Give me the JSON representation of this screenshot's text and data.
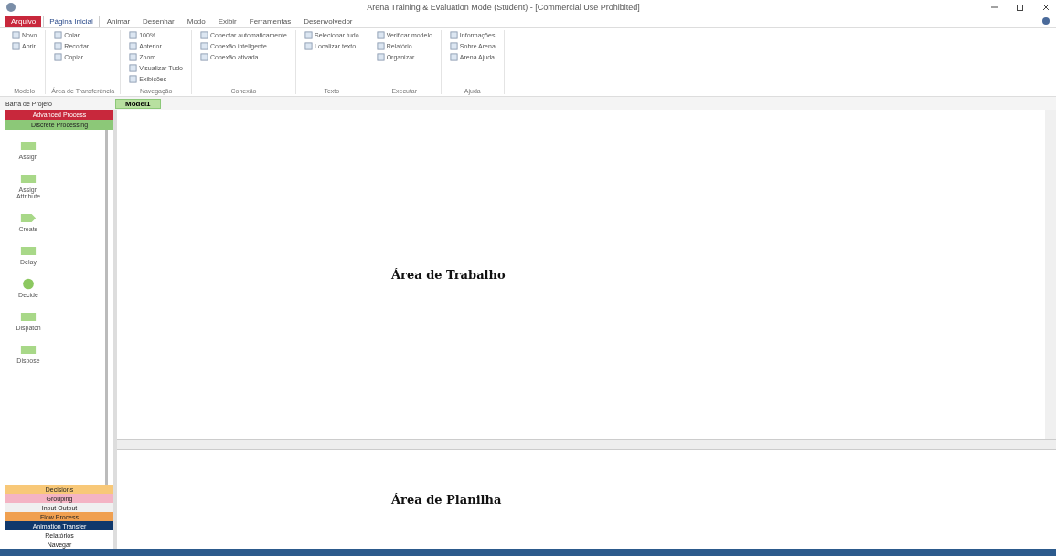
{
  "window": {
    "title": "Arena Training & Evaluation Mode (Student) - [Commercial Use Prohibited]"
  },
  "ribbon_tabs": [
    {
      "label": "Arquivo",
      "selected": false,
      "kind": "file"
    },
    {
      "label": "Página Inicial",
      "selected": true,
      "kind": "tab"
    },
    {
      "label": "Animar",
      "selected": false,
      "kind": "tab"
    },
    {
      "label": "Desenhar",
      "selected": false,
      "kind": "tab"
    },
    {
      "label": "Modo",
      "selected": false,
      "kind": "tab"
    },
    {
      "label": "Exibir",
      "selected": false,
      "kind": "tab"
    },
    {
      "label": "Ferramentas",
      "selected": false,
      "kind": "tab"
    },
    {
      "label": "Desenvolvedor",
      "selected": false,
      "kind": "tab"
    }
  ],
  "ribbon_groups": [
    {
      "label": "Modelo",
      "commands": [
        "Novo",
        "Abrir"
      ]
    },
    {
      "label": "Área de Transferência",
      "commands": [
        "Colar",
        "Recortar",
        "Copiar"
      ]
    },
    {
      "label": "Navegação",
      "commands": [
        "100%",
        "Anterior",
        "Zoom",
        "Visualizar Tudo",
        "Exibições"
      ]
    },
    {
      "label": "Conexão",
      "commands": [
        "Conectar automaticamente",
        "Conexão inteligente",
        "Conexão ativada"
      ]
    },
    {
      "label": "Texto",
      "commands": [
        "Selecionar tudo",
        "Localizar texto"
      ]
    },
    {
      "label": "Executar",
      "commands": [
        "Verificar modelo",
        "Relatório",
        "Organizar"
      ]
    },
    {
      "label": "Ajuda",
      "commands": [
        "Informações",
        "Sobre Arena",
        "Arena Ajuda"
      ]
    }
  ],
  "project_bar": {
    "title": "Barra de Projeto"
  },
  "panels_top": [
    {
      "label": "Advanced Process",
      "color": "#c8283c"
    },
    {
      "label": "Discrete Processing",
      "color": "#8cc878"
    }
  ],
  "modules": [
    {
      "label": "Assign",
      "kind": "rect"
    },
    {
      "label": "Assign Attribute",
      "kind": "rect"
    },
    {
      "label": "Create",
      "kind": "arrow"
    },
    {
      "label": "Delay",
      "kind": "rect"
    },
    {
      "label": "Decide",
      "kind": "circle"
    },
    {
      "label": "Dispatch",
      "kind": "rect"
    },
    {
      "label": "Dispose",
      "kind": "rect"
    }
  ],
  "panels_bottom": [
    {
      "label": "Decisions",
      "color": "#f8c878"
    },
    {
      "label": "Grouping",
      "color": "#f4b4c4"
    },
    {
      "label": "Input Output",
      "color": "#f0f0f0"
    },
    {
      "label": "Flow Process",
      "color": "#f0a050"
    },
    {
      "label": "Animation Transfer",
      "color": "#10386c"
    },
    {
      "label": "Relatórios",
      "color": "#ffffff"
    },
    {
      "label": "Navegar",
      "color": "#ffffff"
    }
  ],
  "document_tab": {
    "label": "Model1",
    "selected": true
  },
  "workspace": {
    "label": "Área de Trabalho"
  },
  "spreadsheet": {
    "label": "Área de Planilha"
  }
}
